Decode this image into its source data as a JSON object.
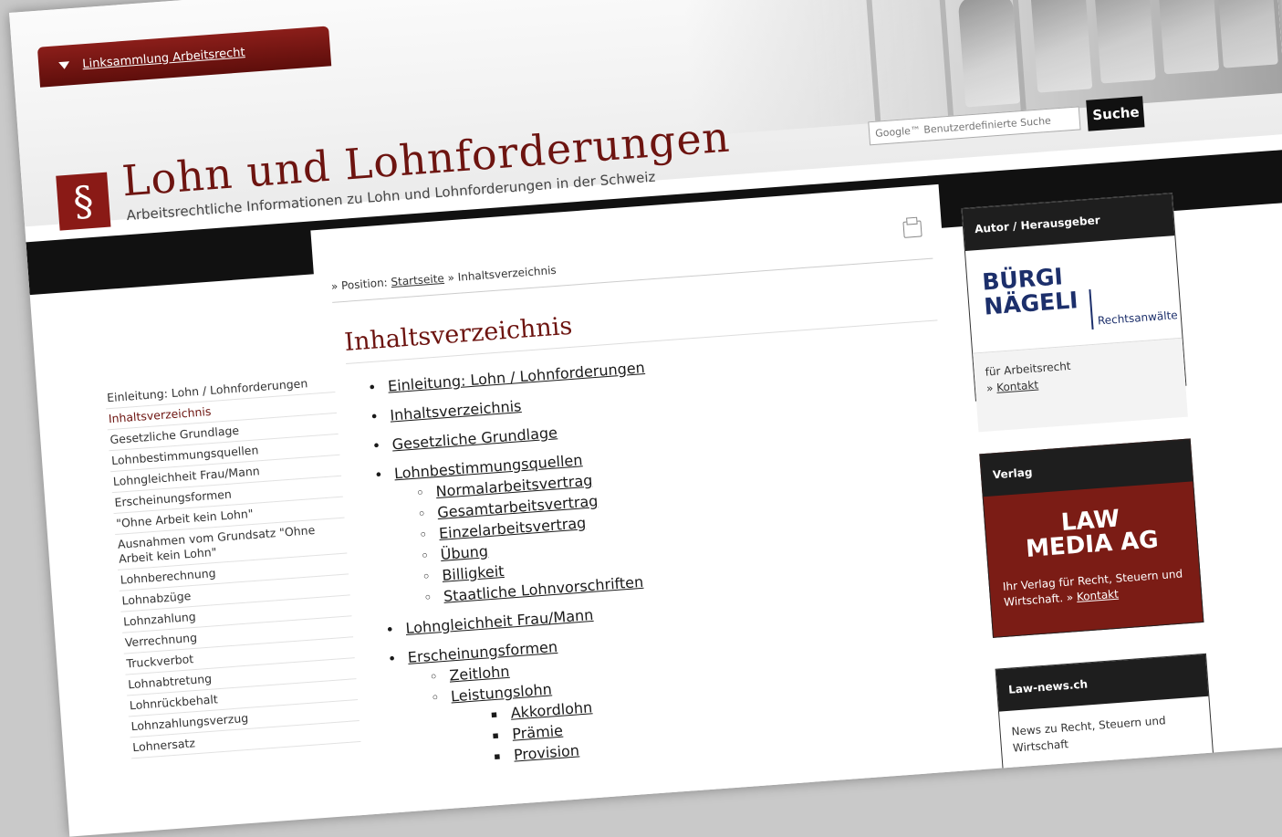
{
  "header": {
    "link_tab": "Linksammlung Arbeitsrecht",
    "logo_symbol": "§",
    "title": "Lohn und Lohnforderungen",
    "subtitle": "Arbeitsrechtliche Informationen zu Lohn und Lohnforderungen in der Schweiz",
    "search_placeholder": "Google™ Benutzerdefinierte Suche",
    "search_button": "Suche"
  },
  "breadcrumb": {
    "prefix": "» Position:",
    "home": "Startseite",
    "sep": "»",
    "current": "Inhaltsverzeichnis"
  },
  "main": {
    "heading": "Inhaltsverzeichnis"
  },
  "toc": [
    {
      "level": 1,
      "label": "Einleitung: Lohn / Lohnforderungen"
    },
    {
      "level": 1,
      "label": "Inhaltsverzeichnis"
    },
    {
      "level": 1,
      "label": "Gesetzliche Grundlage"
    },
    {
      "level": 1,
      "label": "Lohnbestimmungsquellen"
    },
    {
      "level": 2,
      "label": "Normalarbeitsvertrag"
    },
    {
      "level": 2,
      "label": "Gesamtarbeitsvertrag"
    },
    {
      "level": 2,
      "label": "Einzelarbeitsvertrag"
    },
    {
      "level": 2,
      "label": "Übung"
    },
    {
      "level": 2,
      "label": "Billigkeit"
    },
    {
      "level": 2,
      "label": "Staatliche Lohnvorschriften"
    },
    {
      "level": 1,
      "label": "Lohngleichheit Frau/Mann"
    },
    {
      "level": 1,
      "label": "Erscheinungsformen"
    },
    {
      "level": 2,
      "label": "Zeitlohn"
    },
    {
      "level": 2,
      "label": "Leistungslohn"
    },
    {
      "level": 3,
      "label": "Akkordlohn"
    },
    {
      "level": 3,
      "label": "Prämie"
    },
    {
      "level": 3,
      "label": "Provision"
    }
  ],
  "leftnav": [
    "Einleitung: Lohn / Lohnforderungen",
    "Inhaltsverzeichnis",
    "Gesetzliche Grundlage",
    "Lohnbestimmungsquellen",
    "Lohngleichheit Frau/Mann",
    "Erscheinungsformen",
    "\"Ohne Arbeit kein Lohn\"",
    "Ausnahmen vom Grundsatz \"Ohne Arbeit kein Lohn\"",
    "Lohnberechnung",
    "Lohnabzüge",
    "Lohnzahlung",
    "Verrechnung",
    "Truckverbot",
    "Lohnabtretung",
    "Lohnrückbehalt",
    "Lohnzahlungsverzug",
    "Lohnersatz"
  ],
  "leftnav_active_index": 1,
  "sidebar": {
    "author_head": "Autor / Herausgeber",
    "author_logo_line1": "BÜRGI",
    "author_logo_line2": "NÄGELI",
    "author_logo_suffix": "Rechtsanwälte",
    "author_text": "für Arbeitsrecht",
    "author_link_prefix": "»",
    "author_link": "Kontakt",
    "verlag_head": "Verlag",
    "verlag_logo_line1": "LAW",
    "verlag_logo_line2": "MEDIA AG",
    "verlag_text": "Ihr Verlag für Recht, Steuern und Wirtschaft. »",
    "verlag_link": "Kontakt",
    "news_head": "Law-news.ch",
    "news_text": "News zu Recht, Steuern und Wirtschaft"
  },
  "icons": {
    "print": "printer-icon",
    "dropdown": "triangle-down-icon"
  },
  "colors": {
    "brand": "#6d1410",
    "band": "#111111",
    "verlag_bg": "#7b1c15"
  }
}
